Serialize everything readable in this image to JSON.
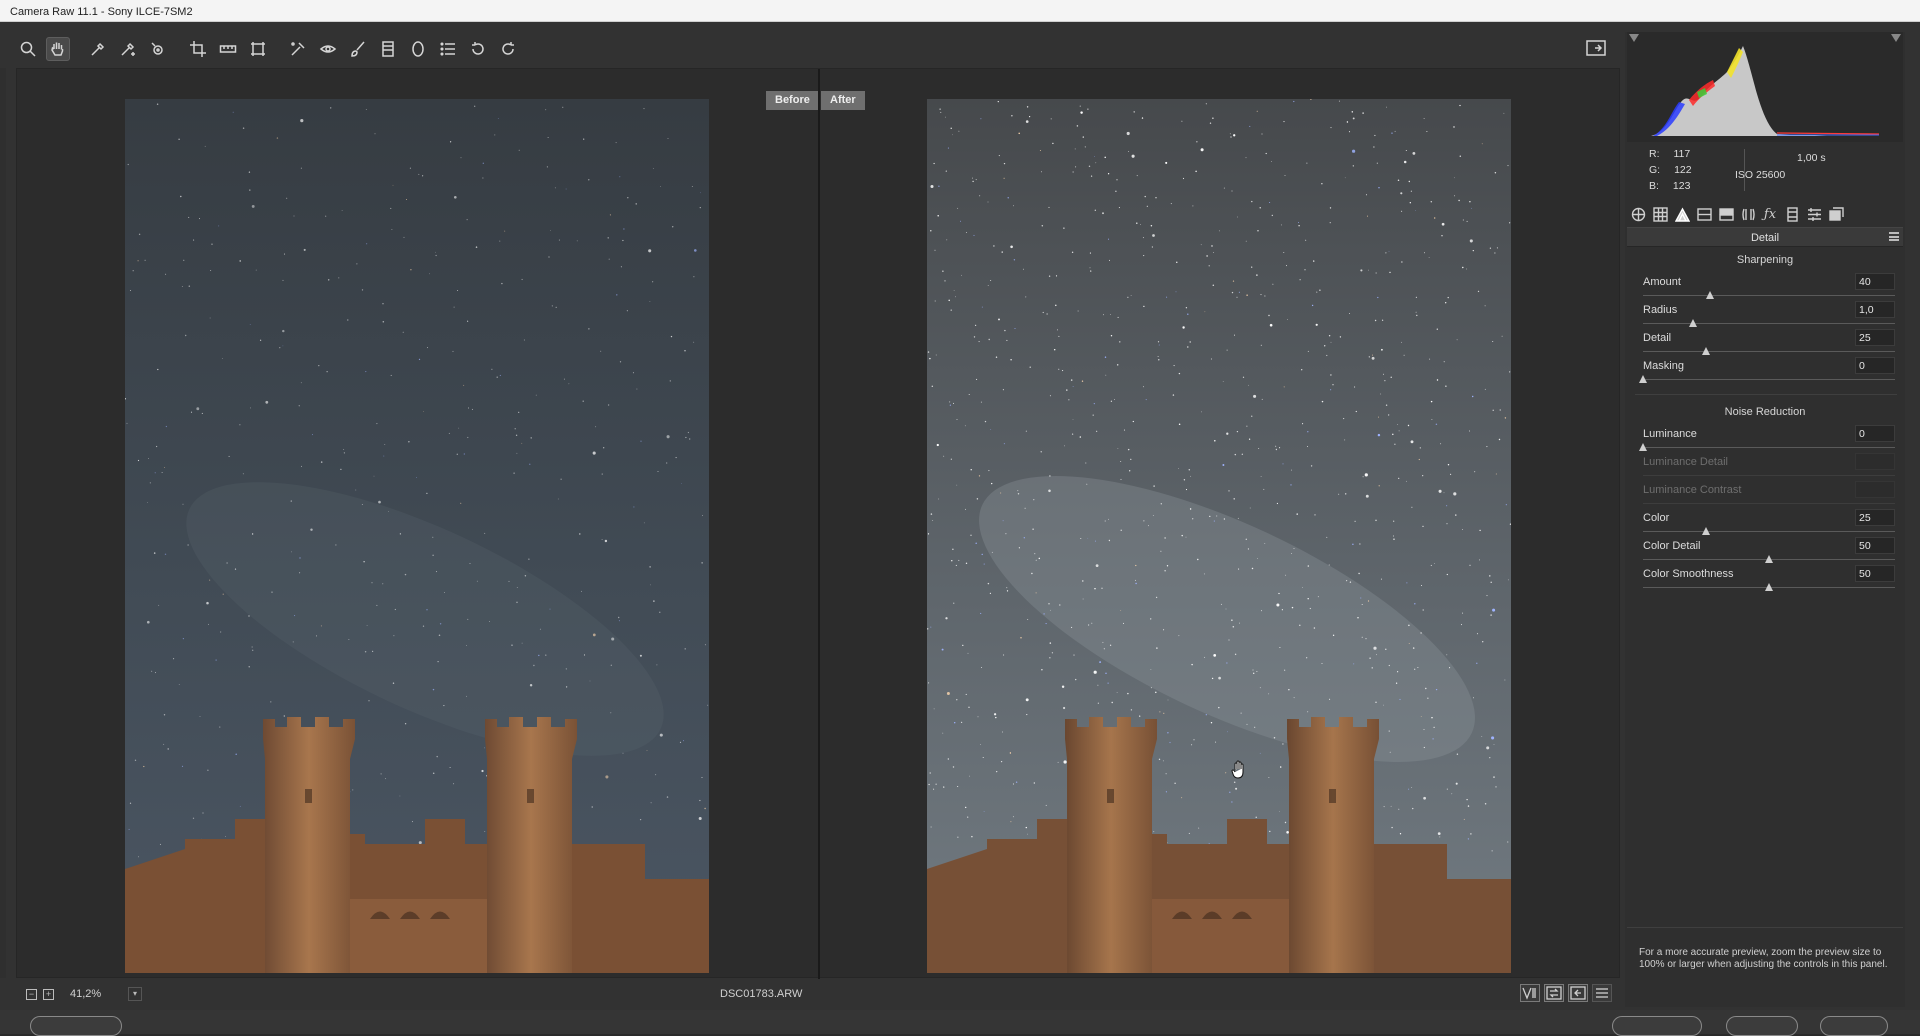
{
  "window": {
    "title": "Camera Raw 11.1  -  Sony ILCE-7SM2"
  },
  "toolbar": {
    "tools": [
      "zoom-tool",
      "hand-tool",
      "white-balance-tool",
      "color-sampler-tool",
      "targeted-adjustment-tool",
      "crop-tool",
      "straighten-tool",
      "transform-tool",
      "spot-removal-tool",
      "red-eye-tool",
      "adjustment-brush-tool",
      "graduated-filter-tool",
      "radial-filter-tool",
      "preferences-tool",
      "rotate-ccw-tool",
      "rotate-cw-tool"
    ],
    "active_tool": "hand-tool"
  },
  "preview": {
    "before_label": "Before",
    "after_label": "After"
  },
  "status": {
    "zoom_level": "41,2%",
    "filename": "DSC01783.ARW"
  },
  "readout": {
    "r_label": "R:",
    "r_value": "117",
    "g_label": "G:",
    "g_value": "122",
    "b_label": "B:",
    "b_value": "123",
    "shutter": "1,00 s",
    "iso": "ISO 25600"
  },
  "panel": {
    "title": "Detail",
    "sharpening": {
      "heading": "Sharpening",
      "controls": [
        {
          "label": "Amount",
          "value": "40",
          "min": 0,
          "max": 150,
          "num": 40
        },
        {
          "label": "Radius",
          "value": "1,0",
          "min": 0.5,
          "max": 3.0,
          "num": 1.0
        },
        {
          "label": "Detail",
          "value": "25",
          "min": 0,
          "max": 100,
          "num": 25
        },
        {
          "label": "Masking",
          "value": "0",
          "min": 0,
          "max": 100,
          "num": 0
        }
      ]
    },
    "noise_reduction": {
      "heading": "Noise Reduction",
      "controls": [
        {
          "label": "Luminance",
          "value": "0",
          "min": 0,
          "max": 100,
          "num": 0,
          "disabled": false
        },
        {
          "label": "Luminance Detail",
          "value": "",
          "disabled": true
        },
        {
          "label": "Luminance Contrast",
          "value": "",
          "disabled": true
        },
        {
          "label": "Color",
          "value": "25",
          "min": 0,
          "max": 100,
          "num": 25,
          "disabled": false
        },
        {
          "label": "Color Detail",
          "value": "50",
          "min": 0,
          "max": 100,
          "num": 50,
          "disabled": false
        },
        {
          "label": "Color Smoothness",
          "value": "50",
          "min": 0,
          "max": 100,
          "num": 50,
          "disabled": false
        }
      ]
    },
    "tip": "For a more accurate preview, zoom the preview size to 100% or larger when adjusting the controls in this panel."
  },
  "colors": {
    "sky_before_top": "#3a4046",
    "sky_before_bottom": "#47525e",
    "sky_after_top": "#4a4f53",
    "sky_after_bottom": "#6c747b",
    "stone": "#9a6a45"
  }
}
